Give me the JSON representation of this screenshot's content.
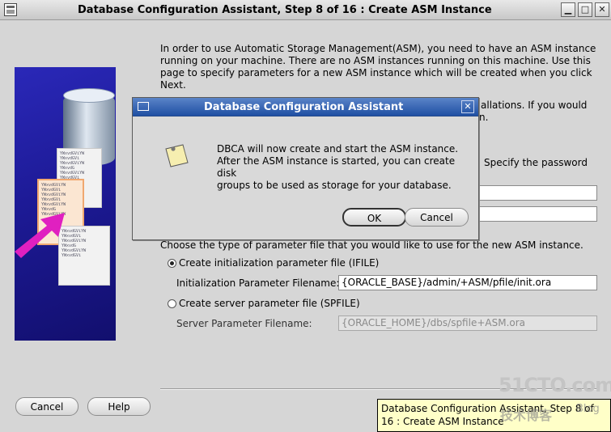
{
  "window": {
    "title": "Database Configuration Assistant, Step 8 of 16 : Create ASM Instance",
    "minimize_label": "▁",
    "maximize_label": "□",
    "close_label": "✕"
  },
  "intro": {
    "line1": "In order to use Automatic Storage Management(ASM), you need to have an ASM instance",
    "line2": "running on your machine. There are no ASM instances running on this machine. Use this",
    "line3": "page to specify parameters for a new ASM instance which will be created when you click",
    "line4": "Next."
  },
  "partial_texts": {
    "line_a": "allations. If you would",
    "line_b": "n.",
    "line_c": "Specify the password"
  },
  "param_file": {
    "prompt": "Choose the type of parameter file that you would like to use for the new ASM instance.",
    "ifile_option": "Create initialization parameter file (IFILE)",
    "ifile_selected": true,
    "ifile_label": "Initialization Parameter Filename:",
    "ifile_value": "{ORACLE_BASE}/admin/+ASM/pfile/init.ora",
    "spfile_option": "Create server parameter file (SPFILE)",
    "spfile_label": "Server Parameter Filename:",
    "spfile_value": "{ORACLE_HOME}/dbs/spfile+ASM.ora"
  },
  "footer": {
    "cancel_label": "Cancel",
    "help_label": "Help"
  },
  "dialog": {
    "title": "Database Configuration Assistant",
    "close_label": "✕",
    "message_line1": "DBCA will now create and start the ASM instance.",
    "message_line2": "After the ASM instance is started, you can create disk",
    "message_line3": "groups to be used as storage for your database.",
    "ok_label": "OK",
    "cancel_label": "Cancel"
  },
  "tooltip": {
    "line1": "Database Configuration Assistant, Step 8 of",
    "line2": "16 : Create ASM Instance"
  },
  "watermark": {
    "site": "51CTO.com",
    "sub": "技术博客",
    "blog": "Blog"
  },
  "colors": {
    "dialog_title_bg": "#1f4fa3",
    "tooltip_bg": "#ffffc8",
    "panel_bg": "#1d1a96",
    "arrow": "#e020c0"
  }
}
